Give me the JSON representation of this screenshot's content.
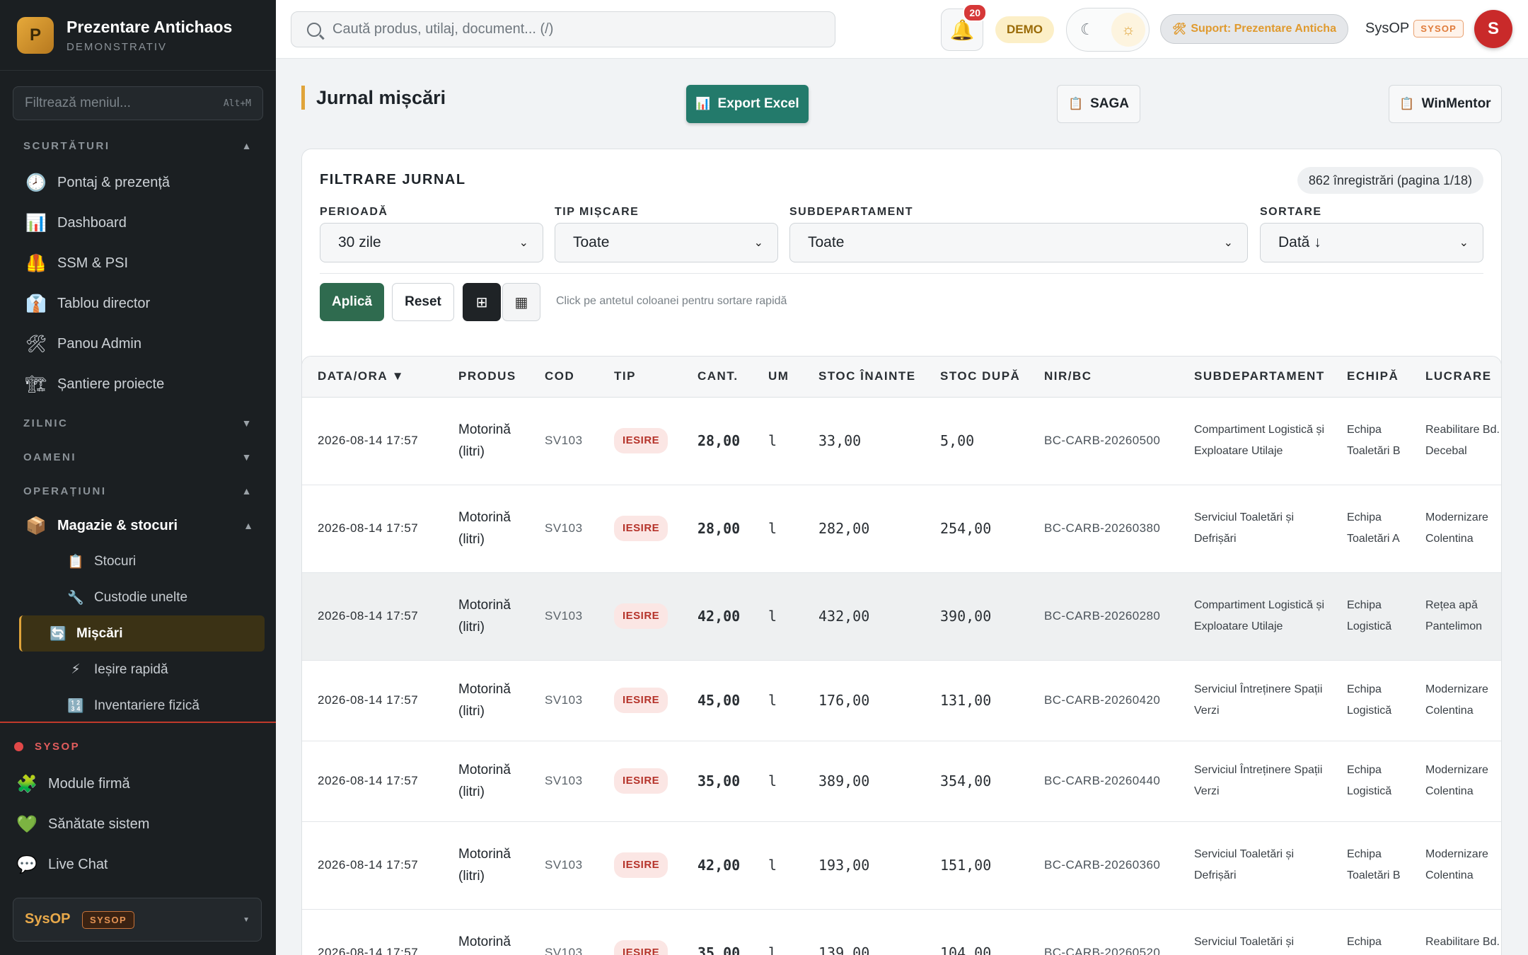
{
  "brand": {
    "logo_letter": "P",
    "title": "Prezentare Antichaos",
    "subtitle": "DEMONSTRATIV"
  },
  "menu_filter": {
    "placeholder": "Filtrează meniul...",
    "shortcut": "Alt+M"
  },
  "sidebar": {
    "shortcuts_label": "SCURTĂTURI",
    "shortcuts": [
      {
        "label": "Pontaj & prezență",
        "icon": "🕗"
      },
      {
        "label": "Dashboard",
        "icon": "📊"
      },
      {
        "label": "SSM & PSI",
        "icon": "🦺"
      },
      {
        "label": "Tablou director",
        "icon": "👔"
      },
      {
        "label": "Panou Admin",
        "icon": "🛠"
      },
      {
        "label": "Șantiere proiecte",
        "icon": "🏗"
      }
    ],
    "zilnic_label": "ZILNIC",
    "oameni_label": "OAMENI",
    "operatiuni_label": "OPERAȚIUNI",
    "group": {
      "label": "Magazie & stocuri",
      "icon": "📦"
    },
    "group_items": [
      {
        "label": "Stocuri",
        "icon": "📋"
      },
      {
        "label": "Custodie unelte",
        "icon": "🔧"
      },
      {
        "label": "Mișcări",
        "icon": "🔄"
      },
      {
        "label": "Ieșire rapidă",
        "icon": "⚡"
      },
      {
        "label": "Inventariere fizică",
        "icon": "🔢"
      }
    ],
    "sysop_label": "SYSOP",
    "sysop_items": [
      {
        "label": "Module firmă",
        "icon": "🧩"
      },
      {
        "label": "Sănătate sistem",
        "icon": "💚"
      },
      {
        "label": "Live Chat",
        "icon": "💬"
      }
    ],
    "user": {
      "name": "SysOP",
      "role": "SYSOP"
    }
  },
  "topbar": {
    "search_placeholder": "Caută produs, utilaj, document... (/)",
    "notif_count": "20",
    "demo": "DEMO",
    "support": "Suport: Prezentare Anticha",
    "user_name": "SysOP",
    "user_role": "SYSOP",
    "avatar_letter": "S"
  },
  "page": {
    "title": "Jurnal mișcări",
    "export_label": "Export Excel",
    "saga_label": "SAGA",
    "winmentor_label": "WinMentor"
  },
  "filters": {
    "title": "FILTRARE JURNAL",
    "records": "862 înregistrări (pagina 1/18)",
    "period_label": "PERIOADĂ",
    "period_value": "30 zile",
    "type_label": "TIP MIȘCARE",
    "type_value": "Toate",
    "subdept_label": "SUBDEPARTAMENT",
    "subdept_value": "Toate",
    "sort_label": "SORTARE",
    "sort_value": "Dată ↓",
    "apply_label": "Aplică",
    "reset_label": "Reset",
    "hint": "Click pe antetul coloanei pentru sortare rapidă"
  },
  "table": {
    "headers": [
      "DATA/ORA ▼",
      "PRODUS",
      "COD",
      "TIP",
      "CANT.",
      "UM",
      "STOC ÎNAINTE",
      "STOC DUPĂ",
      "NIR/BC",
      "SUBDEPARTAMENT",
      "ECHIPĂ",
      "LUCRARE"
    ],
    "rows": [
      {
        "date": "2026-08-14 17:57",
        "product": "Motorină (litri)",
        "code": "SV103",
        "type": "IESIRE",
        "qty": "28,00",
        "um": "l",
        "before": "33,00",
        "after": "5,00",
        "nir": "BC-CARB-20260500",
        "subdept": "Compartiment Logistică și Exploatare Utilaje",
        "team": "Echipa Toaletări B",
        "work": "Reabilitare Bd. Decebal"
      },
      {
        "date": "2026-08-14 17:57",
        "product": "Motorină (litri)",
        "code": "SV103",
        "type": "IESIRE",
        "qty": "28,00",
        "um": "l",
        "before": "282,00",
        "after": "254,00",
        "nir": "BC-CARB-20260380",
        "subdept": "Serviciul Toaletări și Defrișări",
        "team": "Echipa Toaletări A",
        "work": "Modernizare Colentina"
      },
      {
        "date": "2026-08-14 17:57",
        "product": "Motorină (litri)",
        "code": "SV103",
        "type": "IESIRE",
        "qty": "42,00",
        "um": "l",
        "before": "432,00",
        "after": "390,00",
        "nir": "BC-CARB-20260280",
        "subdept": "Compartiment Logistică și Exploatare Utilaje",
        "team": "Echipa Logistică",
        "work": "Rețea apă Pantelimon"
      },
      {
        "date": "2026-08-14 17:57",
        "product": "Motorină (litri)",
        "code": "SV103",
        "type": "IESIRE",
        "qty": "45,00",
        "um": "l",
        "before": "176,00",
        "after": "131,00",
        "nir": "BC-CARB-20260420",
        "subdept": "Serviciul Întreținere Spații Verzi",
        "team": "Echipa Logistică",
        "work": "Modernizare Colentina"
      },
      {
        "date": "2026-08-14 17:57",
        "product": "Motorină (litri)",
        "code": "SV103",
        "type": "IESIRE",
        "qty": "35,00",
        "um": "l",
        "before": "389,00",
        "after": "354,00",
        "nir": "BC-CARB-20260440",
        "subdept": "Serviciul Întreținere Spații Verzi",
        "team": "Echipa Logistică",
        "work": "Modernizare Colentina"
      },
      {
        "date": "2026-08-14 17:57",
        "product": "Motorină (litri)",
        "code": "SV103",
        "type": "IESIRE",
        "qty": "42,00",
        "um": "l",
        "before": "193,00",
        "after": "151,00",
        "nir": "BC-CARB-20260360",
        "subdept": "Serviciul Toaletări și Defrișări",
        "team": "Echipa Toaletări B",
        "work": "Modernizare Colentina"
      },
      {
        "date": "2026-08-14 17:57",
        "product": "Motorină (litri)",
        "code": "SV103",
        "type": "IESIRE",
        "qty": "35,00",
        "um": "l",
        "before": "139,00",
        "after": "104,00",
        "nir": "BC-CARB-20260520",
        "subdept": "Serviciul Toaletări și Defrișări",
        "team": "Echipa Logistică",
        "work": "Reabilitare Bd. Decebal"
      }
    ]
  }
}
